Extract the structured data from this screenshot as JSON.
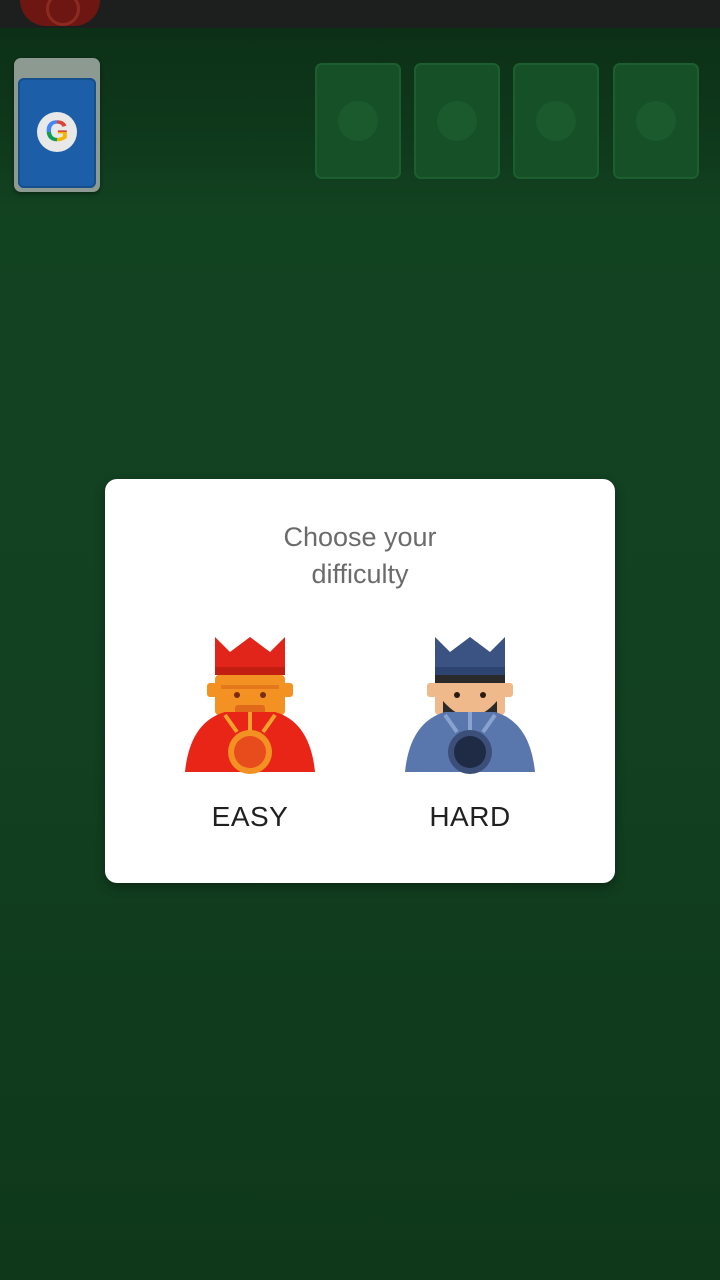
{
  "dialog": {
    "title": "Choose your\ndifficulty",
    "options": [
      {
        "label": "EASY",
        "icon": "red-king-icon",
        "color": "#e83a1c"
      },
      {
        "label": "HARD",
        "icon": "blue-king-icon",
        "color": "#4f6ba3"
      }
    ]
  },
  "stock": {
    "icon": "google-logo-icon"
  },
  "colors": {
    "table": "#124121",
    "card_back": "#1c5fa8"
  }
}
